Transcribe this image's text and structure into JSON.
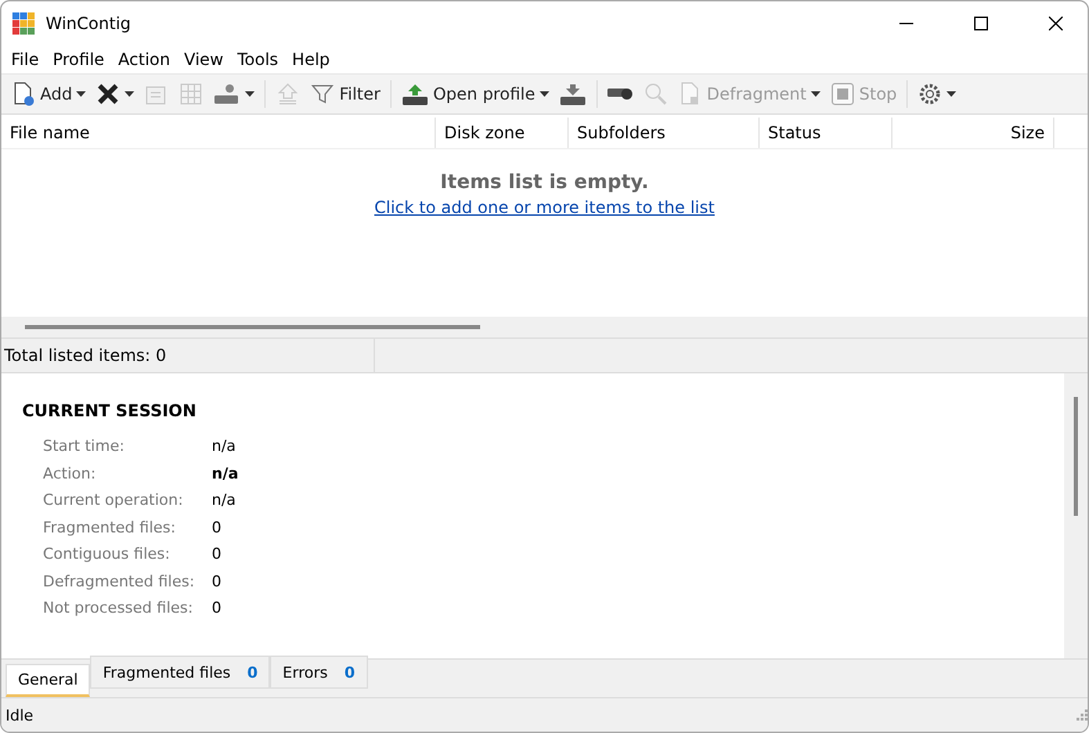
{
  "window": {
    "title": "WinContig"
  },
  "menu": [
    "File",
    "Profile",
    "Action",
    "View",
    "Tools",
    "Help"
  ],
  "toolbar": [
    {
      "kind": "button",
      "label": "Add",
      "dropdown": true,
      "disabled": false
    },
    {
      "kind": "button",
      "dropdown": true,
      "disabled": false
    },
    {
      "kind": "button",
      "dropdown": false,
      "disabled": true
    },
    {
      "kind": "button",
      "dropdown": false,
      "disabled": true
    },
    {
      "kind": "button",
      "dropdown": true,
      "disabled": false
    },
    {
      "kind": "separator"
    },
    {
      "kind": "button",
      "dropdown": false,
      "disabled": true
    },
    {
      "kind": "button",
      "label": "Filter",
      "dropdown": false,
      "disabled": false
    },
    {
      "kind": "separator"
    },
    {
      "kind": "button",
      "label": "Open profile",
      "dropdown": true,
      "disabled": false
    },
    {
      "kind": "button",
      "dropdown": false,
      "disabled": false
    },
    {
      "kind": "separator"
    },
    {
      "kind": "button",
      "dropdown": false,
      "disabled": false
    },
    {
      "kind": "button",
      "dropdown": false,
      "disabled": true
    },
    {
      "kind": "button",
      "label": "Defragment",
      "dropdown": true,
      "disabled": true
    },
    {
      "kind": "button",
      "label": "Stop",
      "dropdown": false,
      "disabled": true
    },
    {
      "kind": "separator"
    },
    {
      "kind": "button",
      "dropdown": true,
      "disabled": false
    }
  ],
  "table": {
    "columns": [
      {
        "label": "File name"
      },
      {
        "label": "Disk zone"
      },
      {
        "label": "Subfolders"
      },
      {
        "label": "Status"
      },
      {
        "label": "Size"
      }
    ],
    "empty_title": "Items list is empty.",
    "empty_link": "Click to add one or more items to the list"
  },
  "list_status": "Total listed items: 0",
  "session": {
    "title": "CURRENT SESSION",
    "rows": [
      {
        "label": "Start time:",
        "value": "n/a",
        "bold": false
      },
      {
        "label": "Action:",
        "value": "n/a",
        "bold": true
      },
      {
        "label": "Current operation:",
        "value": "n/a",
        "bold": false
      },
      {
        "label": "Fragmented files:",
        "value": "0",
        "bold": false
      },
      {
        "label": "Contiguous files:",
        "value": "0",
        "bold": false
      },
      {
        "label": "Defragmented files:",
        "value": "0",
        "bold": false
      },
      {
        "label": "Not processed files:",
        "value": "0",
        "bold": false
      }
    ]
  },
  "tabs": [
    {
      "label": "General",
      "selected": true
    },
    {
      "label": "Fragmented files",
      "count": "0",
      "selected": false
    },
    {
      "label": "Errors",
      "count": "0",
      "selected": false
    }
  ],
  "status_bar": "Idle"
}
